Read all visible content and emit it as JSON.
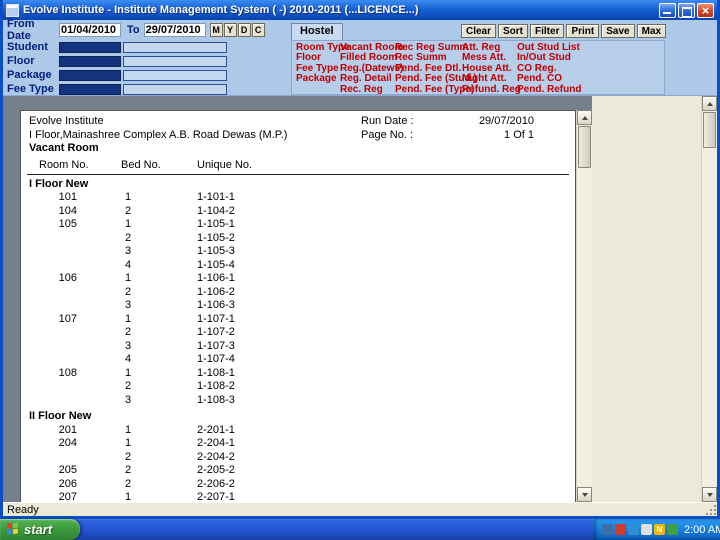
{
  "window": {
    "title": "Evolve Institute - Institute Management System ( -) 2010-2011 (...LICENCE...)"
  },
  "colors": {
    "link_red": "#C00000",
    "label_navy": "#00217C",
    "frame_blue": "#0A4FC4",
    "band_blue": "#AEC8E8",
    "desktop_gray": "#75808C",
    "beige": "#ECE9D8",
    "start_green": "#3D9B3D"
  },
  "toolbar": {
    "from_date_label": "From Date",
    "from_date_value": "01/04/2010",
    "to_label": "To",
    "to_date_value": "29/07/2010",
    "date_buttons": [
      "M",
      "Y",
      "D",
      "C"
    ],
    "filter_labels": [
      "Student",
      "Floor",
      "Package",
      "Fee Type"
    ],
    "tab_label": "Hostel",
    "action_buttons": [
      "Clear",
      "Sort",
      "Filter",
      "Print",
      "Save",
      "Max"
    ],
    "report_links": [
      [
        "Room Type",
        "Floor",
        "Fee Type",
        "Package"
      ],
      [
        "Vacant Room",
        "Filled Room",
        "Reg.(Datews)",
        "Reg. Detail",
        "Rec. Reg"
      ],
      [
        "Rec Reg Summ",
        "Rec Summ",
        "Pend. Fee Dtl.",
        "Pend. Fee (Stud.)",
        "Pend. Fee (Type)"
      ],
      [
        "Att. Reg",
        "Mess Att.",
        "House Att.",
        "Night Att.",
        "Refund. Reg"
      ],
      [
        "Out Stud List",
        "In/Out Stud",
        "CO Reg.",
        "Pend. CO",
        "Pend. Refund"
      ]
    ]
  },
  "report": {
    "institute": "Evolve Institute",
    "address": "I Floor,Mainashree Complex A.B. Road Dewas (M.P.)",
    "run_date_label": "Run Date :",
    "run_date": "29/07/2010",
    "page_no_label": "Page No. :",
    "page_no": "1 Of 1",
    "title": "Vacant Room",
    "columns": [
      "Room No.",
      "Bed No.",
      "Unique No."
    ],
    "sections": [
      {
        "name": "I Floor New",
        "rows": [
          [
            "101",
            "1",
            "1-101-1"
          ],
          [
            "104",
            "2",
            "1-104-2"
          ],
          [
            "105",
            "1",
            "1-105-1"
          ],
          [
            "",
            "2",
            "1-105-2"
          ],
          [
            "",
            "3",
            "1-105-3"
          ],
          [
            "",
            "4",
            "1-105-4"
          ],
          [
            "106",
            "1",
            "1-106-1"
          ],
          [
            "",
            "2",
            "1-106-2"
          ],
          [
            "",
            "3",
            "1-106-3"
          ],
          [
            "107",
            "1",
            "1-107-1"
          ],
          [
            "",
            "2",
            "1-107-2"
          ],
          [
            "",
            "3",
            "1-107-3"
          ],
          [
            "",
            "4",
            "1-107-4"
          ],
          [
            "108",
            "1",
            "1-108-1"
          ],
          [
            "",
            "2",
            "1-108-2"
          ],
          [
            "",
            "3",
            "1-108-3"
          ]
        ]
      },
      {
        "name": "II Floor New",
        "rows": [
          [
            "201",
            "1",
            "2-201-1"
          ],
          [
            "204",
            "1",
            "2-204-1"
          ],
          [
            "",
            "2",
            "2-204-2"
          ],
          [
            "205",
            "2",
            "2-205-2"
          ],
          [
            "206",
            "2",
            "2-206-2"
          ],
          [
            "207",
            "1",
            "2-207-1"
          ]
        ]
      }
    ]
  },
  "statusbar": {
    "text": "Ready"
  },
  "taskbar": {
    "start_label": "start",
    "time": "2:00 AM",
    "tray_icons": [
      {
        "name": "network-icon",
        "color": "#3B6EA5"
      },
      {
        "name": "antivirus-icon",
        "color": "#D23A2E"
      },
      {
        "name": "messenger-icon",
        "color": "#2E8FD2"
      },
      {
        "name": "volume-icon",
        "color": "#E0E0E0"
      },
      {
        "name": "norton-icon",
        "color": "#F5B800",
        "glyph": "N"
      },
      {
        "name": "security-icon",
        "color": "#3FA03F"
      }
    ]
  }
}
